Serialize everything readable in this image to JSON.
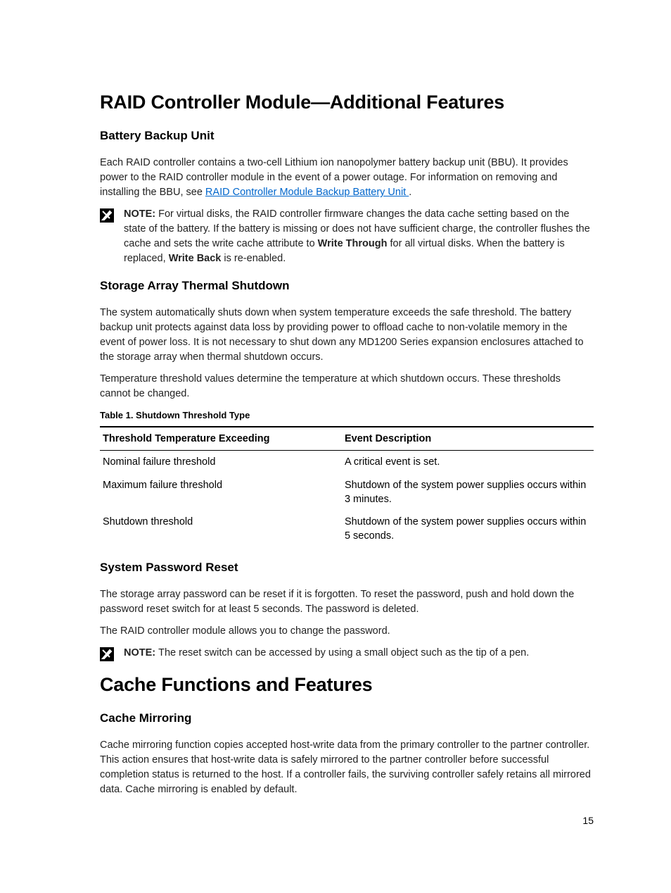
{
  "h1_a": "RAID Controller Module—Additional Features",
  "h2_bbu": "Battery Backup Unit",
  "p_bbu_1a": "Each RAID controller contains a two-cell Lithium ion nanopolymer battery backup unit (BBU). It provides power to the RAID controller module in the event of a power outage. For information on removing and installing the BBU, see ",
  "p_bbu_link": "RAID Controller Module Backup Battery Unit ",
  "p_bbu_1b": ".",
  "note1_label": "NOTE: ",
  "note1_a": "For virtual disks, the RAID controller firmware changes the data cache setting based on the state of the battery. If the battery is missing or does not have sufficient charge, the controller flushes the cache and sets the write cache attribute to ",
  "note1_b1": "Write Through",
  "note1_c": " for all virtual disks. When the battery is replaced, ",
  "note1_b2": "Write Back",
  "note1_d": " is re-enabled.",
  "h2_thermal": "Storage Array Thermal Shutdown",
  "p_thermal_1": "The system automatically shuts down when system temperature exceeds the safe threshold. The battery backup unit protects against data loss by providing power to offload cache to non-volatile memory in the event of power loss. It is not necessary to shut down any MD1200 Series expansion enclosures attached to the storage array when thermal shutdown occurs.",
  "p_thermal_2": "Temperature threshold values determine the temperature at which shutdown occurs. These thresholds cannot be changed.",
  "table_caption": "Table 1. Shutdown Threshold Type",
  "th1": "Threshold Temperature Exceeding",
  "th2": "Event Description",
  "rows": [
    {
      "c1": "Nominal failure threshold",
      "c2": "A critical event is set."
    },
    {
      "c1": "Maximum failure threshold",
      "c2": "Shutdown of the system power supplies occurs within 3 minutes."
    },
    {
      "c1": "Shutdown threshold",
      "c2": "Shutdown of the system power supplies occurs within 5 seconds."
    }
  ],
  "h2_pwd": "System Password Reset",
  "p_pwd_1": "The storage array password can be reset if it is forgotten. To reset the password, push and hold down the password reset switch for at least 5 seconds. The password is deleted.",
  "p_pwd_2": "The RAID controller module allows you to change the password.",
  "note2_label": "NOTE: ",
  "note2_body": "The reset switch can be accessed by using a small object such as the tip of a pen.",
  "h1_b": "Cache Functions and Features",
  "h2_mirror": "Cache Mirroring",
  "p_mirror_1": "Cache mirroring function copies accepted host-write data from the primary controller to the partner controller. This action ensures that host-write data is safely mirrored to the partner controller before successful completion status is returned to the host. If a controller fails, the surviving controller safely retains all mirrored data. Cache mirroring is enabled by default.",
  "pagenum": "15"
}
